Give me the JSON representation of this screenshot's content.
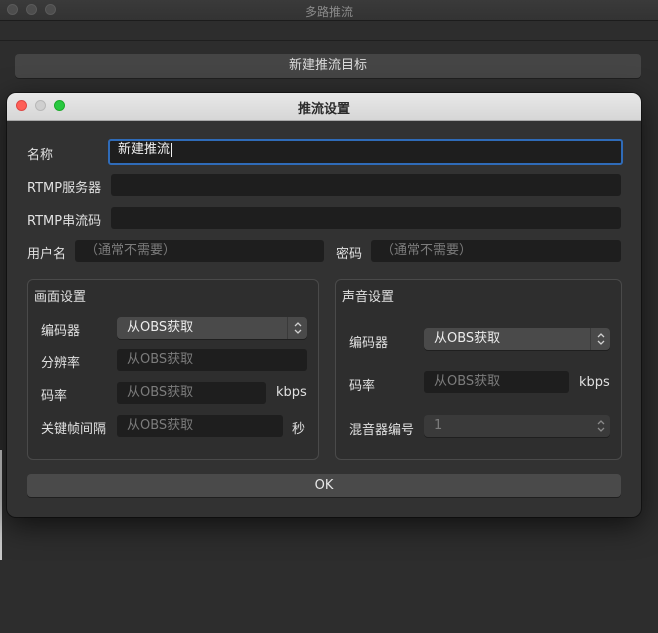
{
  "background_window": {
    "title": "多路推流",
    "new_target_button": "新建推流目标"
  },
  "dialog": {
    "title": "推流设置",
    "name": {
      "label": "名称",
      "value": "新建推流"
    },
    "rtmp_server": {
      "label": "RTMP服务器",
      "value": ""
    },
    "rtmp_key": {
      "label": "RTMP串流码",
      "value": ""
    },
    "username": {
      "label": "用户名",
      "placeholder": "（通常不需要）"
    },
    "password": {
      "label": "密码",
      "placeholder": "（通常不需要）"
    },
    "video": {
      "title": "画面设置",
      "encoder": {
        "label": "编码器",
        "value": "从OBS获取"
      },
      "resolution": {
        "label": "分辨率",
        "placeholder": "从OBS获取"
      },
      "bitrate": {
        "label": "码率",
        "placeholder": "从OBS获取",
        "unit": "kbps"
      },
      "keyframe": {
        "label": "关键帧间隔",
        "placeholder": "从OBS获取",
        "unit": "秒"
      }
    },
    "audio": {
      "title": "声音设置",
      "encoder": {
        "label": "编码器",
        "value": "从OBS获取"
      },
      "bitrate": {
        "label": "码率",
        "placeholder": "从OBS获取",
        "unit": "kbps"
      },
      "mixer": {
        "label": "混音器编号",
        "value": "1"
      }
    },
    "ok_button": "OK"
  },
  "colors": {
    "focus_ring": "#2f6bb8",
    "close": "#fe5f57",
    "zoom": "#28c840"
  }
}
